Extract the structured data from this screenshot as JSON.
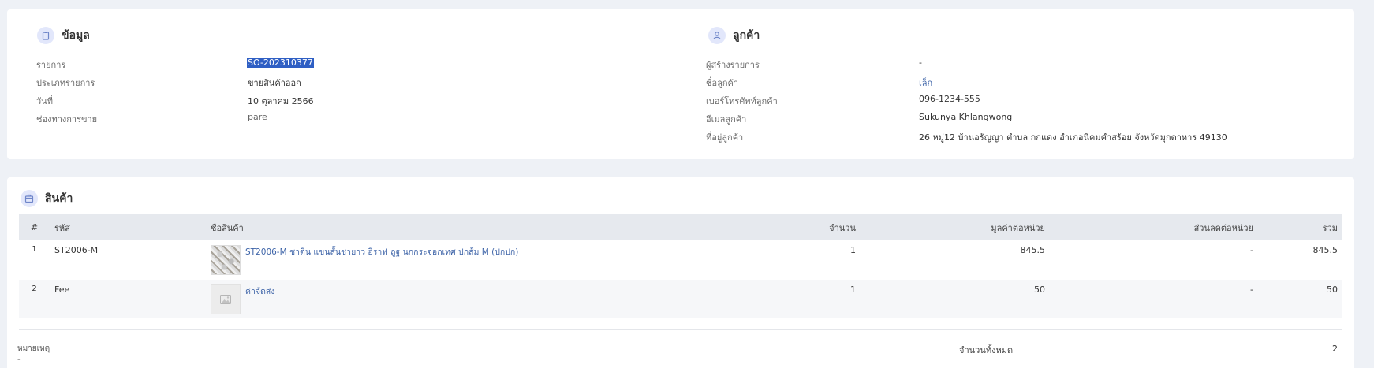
{
  "info": {
    "title": "ข้อมูล",
    "rows": [
      {
        "label": "รายการ",
        "value": "SO-202310377"
      },
      {
        "label": "ประเภทรายการ",
        "value": "ขายสินค้าออก"
      },
      {
        "label": "วันที่",
        "value": "10 ตุลาคม 2566"
      },
      {
        "label": "ช่องทางการขาย",
        "value": "pare"
      }
    ]
  },
  "customer": {
    "title": "ลูกค้า",
    "rows": [
      {
        "label": "ผู้สร้างรายการ",
        "value": "-"
      },
      {
        "label": "ชื่อลูกค้า",
        "value": "เล็ก"
      },
      {
        "label": "เบอร์โทรศัพท์ลูกค้า",
        "value": "096-1234-555"
      },
      {
        "label": "อีเมลลูกค้า",
        "value": "Sukunya Khlangwong"
      },
      {
        "label": "ที่อยู่ลูกค้า",
        "value": "26 หมู่12 บ้านอรัญญา ตำบล กกแดง อำเภอนิคมคำสร้อย จังหวัดมุกดาหาร 49130"
      }
    ]
  },
  "products": {
    "title": "สินค้า",
    "columns": [
      "#",
      "รหัส",
      "ชื่อสินค้า",
      "จำนวน",
      "มูลค่าต่อหน่วย",
      "ส่วนลดต่อหน่วย",
      "รวม"
    ],
    "rows": [
      {
        "index": "1",
        "code": "ST2006-M",
        "name": "ST2006-M ชาติน แขนสั้นชายาว ฮิราฟ ถูฐ นกกระจอกเทศ ปกส้ม M (ปกปก)",
        "qty": "1",
        "unit_price": "845.5",
        "discount": "-",
        "total": "845.5",
        "thumb": "product-photo"
      },
      {
        "index": "2",
        "code": "Fee",
        "name": "ค่าจัดส่ง",
        "qty": "1",
        "unit_price": "50",
        "discount": "-",
        "total": "50",
        "thumb": "image-placeholder-icon"
      }
    ],
    "note_label": "หมายเหตุ",
    "note_value": "-",
    "summary_label": "จำนวนทั้งหมด",
    "summary_value": "2"
  },
  "colors": {
    "accent": "#3e64a8",
    "selection": "#2f5fc4",
    "background": "#eef1f6"
  }
}
